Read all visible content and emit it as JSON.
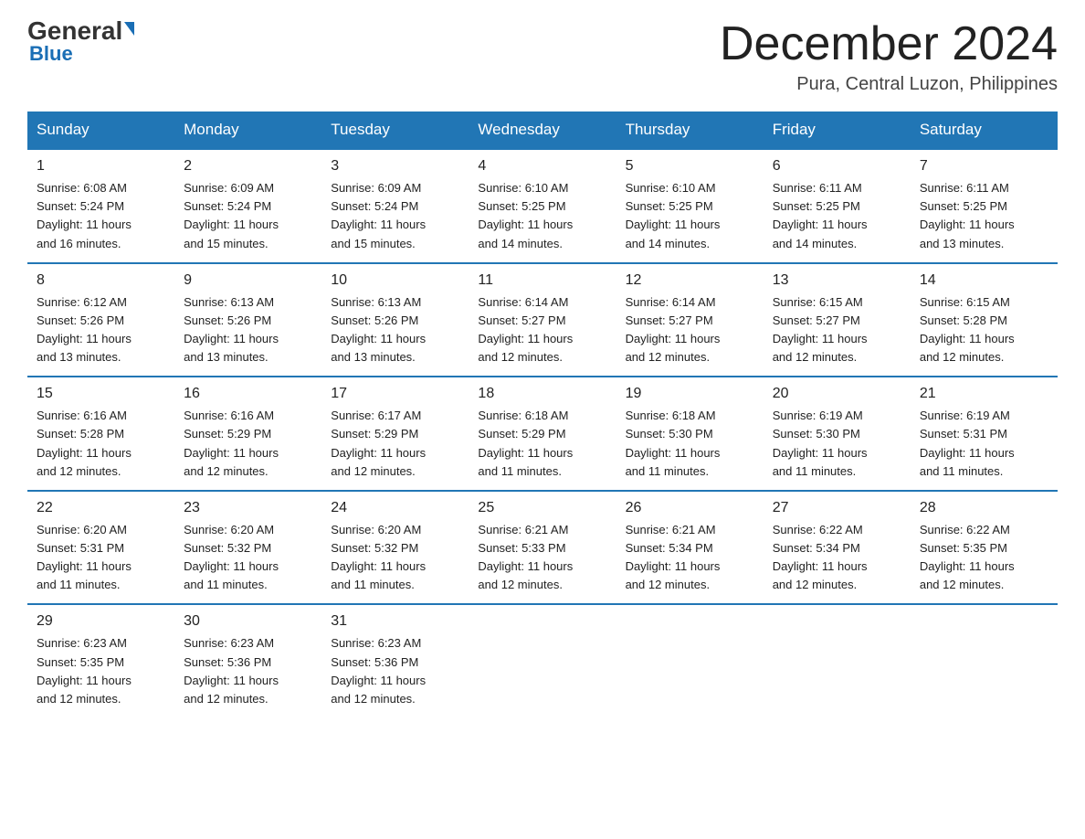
{
  "logo": {
    "general": "General",
    "arrow": "▶",
    "blue": "Blue"
  },
  "header": {
    "month_title": "December 2024",
    "location": "Pura, Central Luzon, Philippines"
  },
  "days_of_week": [
    "Sunday",
    "Monday",
    "Tuesday",
    "Wednesday",
    "Thursday",
    "Friday",
    "Saturday"
  ],
  "weeks": [
    [
      {
        "day": "1",
        "sunrise": "6:08 AM",
        "sunset": "5:24 PM",
        "daylight": "11 hours and 16 minutes."
      },
      {
        "day": "2",
        "sunrise": "6:09 AM",
        "sunset": "5:24 PM",
        "daylight": "11 hours and 15 minutes."
      },
      {
        "day": "3",
        "sunrise": "6:09 AM",
        "sunset": "5:24 PM",
        "daylight": "11 hours and 15 minutes."
      },
      {
        "day": "4",
        "sunrise": "6:10 AM",
        "sunset": "5:25 PM",
        "daylight": "11 hours and 14 minutes."
      },
      {
        "day": "5",
        "sunrise": "6:10 AM",
        "sunset": "5:25 PM",
        "daylight": "11 hours and 14 minutes."
      },
      {
        "day": "6",
        "sunrise": "6:11 AM",
        "sunset": "5:25 PM",
        "daylight": "11 hours and 14 minutes."
      },
      {
        "day": "7",
        "sunrise": "6:11 AM",
        "sunset": "5:25 PM",
        "daylight": "11 hours and 13 minutes."
      }
    ],
    [
      {
        "day": "8",
        "sunrise": "6:12 AM",
        "sunset": "5:26 PM",
        "daylight": "11 hours and 13 minutes."
      },
      {
        "day": "9",
        "sunrise": "6:13 AM",
        "sunset": "5:26 PM",
        "daylight": "11 hours and 13 minutes."
      },
      {
        "day": "10",
        "sunrise": "6:13 AM",
        "sunset": "5:26 PM",
        "daylight": "11 hours and 13 minutes."
      },
      {
        "day": "11",
        "sunrise": "6:14 AM",
        "sunset": "5:27 PM",
        "daylight": "11 hours and 12 minutes."
      },
      {
        "day": "12",
        "sunrise": "6:14 AM",
        "sunset": "5:27 PM",
        "daylight": "11 hours and 12 minutes."
      },
      {
        "day": "13",
        "sunrise": "6:15 AM",
        "sunset": "5:27 PM",
        "daylight": "11 hours and 12 minutes."
      },
      {
        "day": "14",
        "sunrise": "6:15 AM",
        "sunset": "5:28 PM",
        "daylight": "11 hours and 12 minutes."
      }
    ],
    [
      {
        "day": "15",
        "sunrise": "6:16 AM",
        "sunset": "5:28 PM",
        "daylight": "11 hours and 12 minutes."
      },
      {
        "day": "16",
        "sunrise": "6:16 AM",
        "sunset": "5:29 PM",
        "daylight": "11 hours and 12 minutes."
      },
      {
        "day": "17",
        "sunrise": "6:17 AM",
        "sunset": "5:29 PM",
        "daylight": "11 hours and 12 minutes."
      },
      {
        "day": "18",
        "sunrise": "6:18 AM",
        "sunset": "5:29 PM",
        "daylight": "11 hours and 11 minutes."
      },
      {
        "day": "19",
        "sunrise": "6:18 AM",
        "sunset": "5:30 PM",
        "daylight": "11 hours and 11 minutes."
      },
      {
        "day": "20",
        "sunrise": "6:19 AM",
        "sunset": "5:30 PM",
        "daylight": "11 hours and 11 minutes."
      },
      {
        "day": "21",
        "sunrise": "6:19 AM",
        "sunset": "5:31 PM",
        "daylight": "11 hours and 11 minutes."
      }
    ],
    [
      {
        "day": "22",
        "sunrise": "6:20 AM",
        "sunset": "5:31 PM",
        "daylight": "11 hours and 11 minutes."
      },
      {
        "day": "23",
        "sunrise": "6:20 AM",
        "sunset": "5:32 PM",
        "daylight": "11 hours and 11 minutes."
      },
      {
        "day": "24",
        "sunrise": "6:20 AM",
        "sunset": "5:32 PM",
        "daylight": "11 hours and 11 minutes."
      },
      {
        "day": "25",
        "sunrise": "6:21 AM",
        "sunset": "5:33 PM",
        "daylight": "11 hours and 12 minutes."
      },
      {
        "day": "26",
        "sunrise": "6:21 AM",
        "sunset": "5:34 PM",
        "daylight": "11 hours and 12 minutes."
      },
      {
        "day": "27",
        "sunrise": "6:22 AM",
        "sunset": "5:34 PM",
        "daylight": "11 hours and 12 minutes."
      },
      {
        "day": "28",
        "sunrise": "6:22 AM",
        "sunset": "5:35 PM",
        "daylight": "11 hours and 12 minutes."
      }
    ],
    [
      {
        "day": "29",
        "sunrise": "6:23 AM",
        "sunset": "5:35 PM",
        "daylight": "11 hours and 12 minutes."
      },
      {
        "day": "30",
        "sunrise": "6:23 AM",
        "sunset": "5:36 PM",
        "daylight": "11 hours and 12 minutes."
      },
      {
        "day": "31",
        "sunrise": "6:23 AM",
        "sunset": "5:36 PM",
        "daylight": "11 hours and 12 minutes."
      },
      {
        "day": "",
        "sunrise": "",
        "sunset": "",
        "daylight": ""
      },
      {
        "day": "",
        "sunrise": "",
        "sunset": "",
        "daylight": ""
      },
      {
        "day": "",
        "sunrise": "",
        "sunset": "",
        "daylight": ""
      },
      {
        "day": "",
        "sunrise": "",
        "sunset": "",
        "daylight": ""
      }
    ]
  ],
  "labels": {
    "sunrise": "Sunrise:",
    "sunset": "Sunset:",
    "daylight": "Daylight:"
  }
}
